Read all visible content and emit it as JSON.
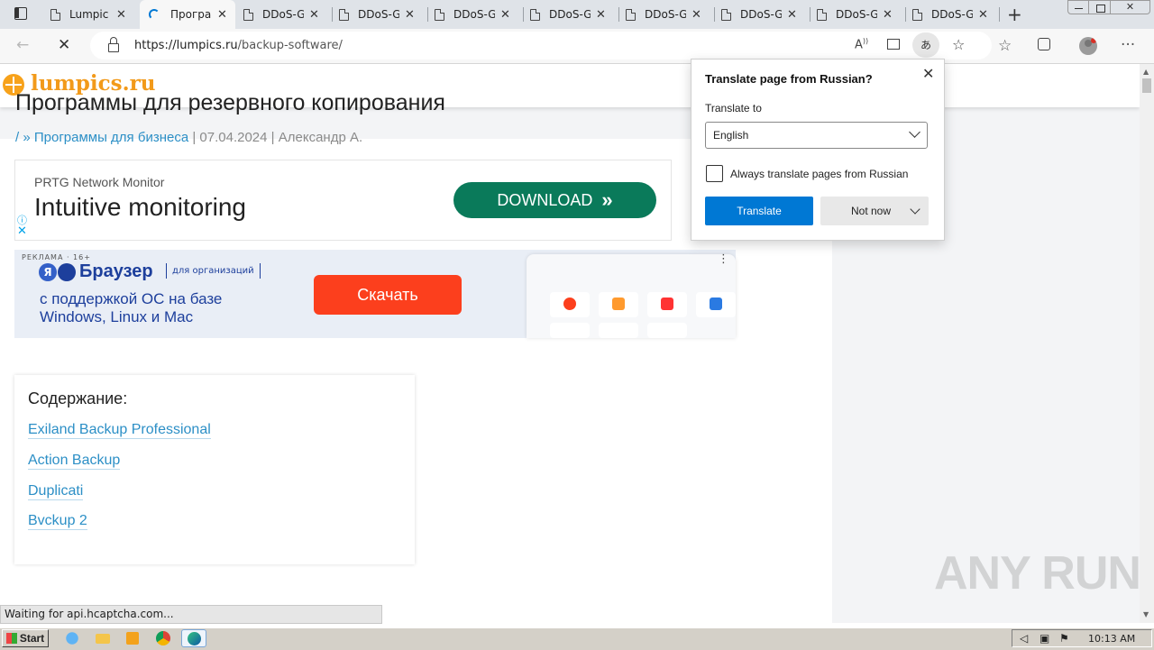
{
  "browser": {
    "tabs": [
      {
        "label": "Lumpic",
        "active": false
      },
      {
        "label": "Програ",
        "active": true
      },
      {
        "label": "DDoS-G",
        "active": false
      },
      {
        "label": "DDoS-G",
        "active": false
      },
      {
        "label": "DDoS-G",
        "active": false
      },
      {
        "label": "DDoS-G",
        "active": false
      },
      {
        "label": "DDoS-G",
        "active": false
      },
      {
        "label": "DDoS-G",
        "active": false
      },
      {
        "label": "DDoS-G",
        "active": false
      },
      {
        "label": "DDoS-G",
        "active": false
      }
    ],
    "url": {
      "host": "https://lumpics.ru",
      "path": "/backup-software/"
    },
    "status_text": "Waiting for api.hcaptcha.com..."
  },
  "site": {
    "logo_text": "lumpics.ru",
    "title": "Программы для резервного копирования",
    "meta": {
      "crumb_prefix": "/ »",
      "category": "Программы для бизнеса",
      "date": "07.04.2024",
      "author": "Александр А."
    }
  },
  "ad1": {
    "brand": "PRTG Network Monitor",
    "headline": "Intuitive monitoring",
    "cta": "DOWNLOAD"
  },
  "ad2": {
    "tag": "РЕКЛАМА · 16+",
    "brand": "Браузер",
    "brand_sub": "для организаций",
    "line1": "с поддержкой ОС на базе",
    "line2": "Windows, Linux и Mac",
    "cta": "Скачать"
  },
  "toc": {
    "title": "Содержание:",
    "items": [
      "Exiland Backup Professional",
      "Action Backup",
      "Duplicati",
      "Bvckup 2"
    ]
  },
  "translate_popup": {
    "title": "Translate page from Russian?",
    "translate_to_label": "Translate to",
    "language": "English",
    "always_label": "Always translate pages from Russian",
    "always_checked": false,
    "translate_button": "Translate",
    "not_now_button": "Not now"
  },
  "taskbar": {
    "start_label": "Start",
    "clock": "10:13 AM"
  },
  "watermark": "ANY RUN",
  "colors": {
    "accent": "#0078d4",
    "link": "#2c8fc6",
    "logo": "#f29a1a",
    "ad_cta_green": "#0a7a5a",
    "ad_cta_red": "#fc3f1d"
  }
}
